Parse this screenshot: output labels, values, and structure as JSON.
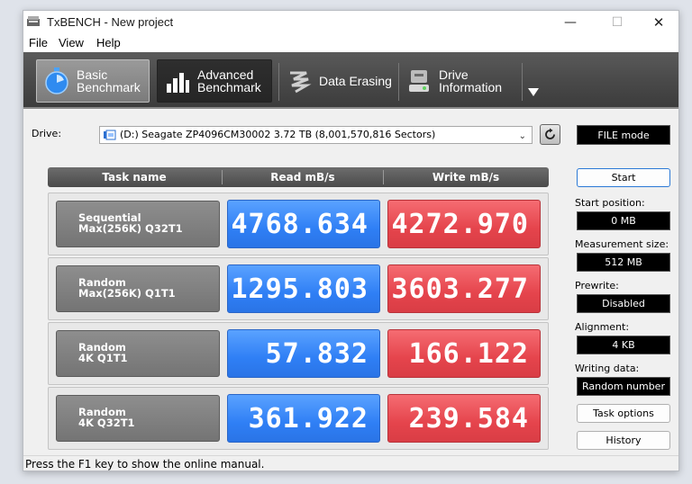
{
  "window": {
    "title": "TxBENCH - New project",
    "min_glyph": "—",
    "max_glyph": "☐",
    "close_glyph": "✕"
  },
  "menu": [
    "File",
    "View",
    "Help"
  ],
  "toolbar": {
    "basic": "Basic\nBenchmark",
    "advanced": "Advanced\nBenchmark",
    "erasing": "Data Erasing",
    "drive_info": "Drive\nInformation"
  },
  "drive": {
    "label": "Drive:",
    "selected": "(D:) Seagate ZP4096CM30002  3.72 TB (8,001,570,816 Sectors)",
    "mode": "FILE mode"
  },
  "grid": {
    "headers": [
      "Task name",
      "Read mB/s",
      "Write mB/s"
    ],
    "rows": [
      {
        "task_line1": "Sequential",
        "task_line2": "Max(256K) Q32T1",
        "read": "4768.634",
        "write": "4272.970"
      },
      {
        "task_line1": "Random",
        "task_line2": "Max(256K) Q1T1",
        "read": "1295.803",
        "write": "3603.277"
      },
      {
        "task_line1": "Random",
        "task_line2": "4K Q1T1",
        "read": "57.832",
        "write": "166.122"
      },
      {
        "task_line1": "Random",
        "task_line2": "4K Q32T1",
        "read": "361.922",
        "write": "239.584"
      }
    ]
  },
  "side": {
    "start": "Start",
    "start_position_label": "Start position:",
    "start_position": "0 MB",
    "measurement_size_label": "Measurement size:",
    "measurement_size": "512 MB",
    "prewrite_label": "Prewrite:",
    "prewrite": "Disabled",
    "alignment_label": "Alignment:",
    "alignment": "4 KB",
    "writing_data_label": "Writing data:",
    "writing_data": "Random number",
    "task_options": "Task options",
    "history": "History"
  },
  "status": "Press the F1 key to show the online manual.",
  "colors": {
    "read": "#2f7ff5",
    "write": "#e5444c",
    "toolbar": "#4a4a4a"
  }
}
